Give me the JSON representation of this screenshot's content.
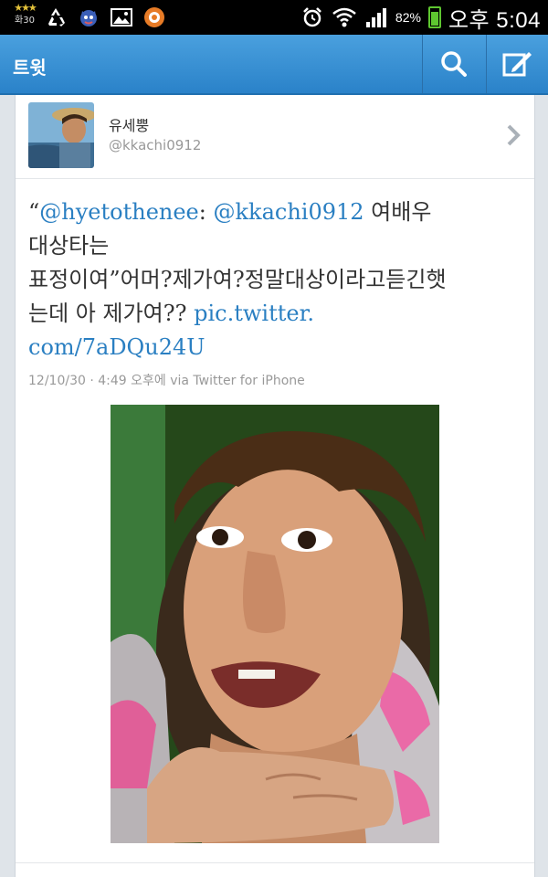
{
  "status_bar": {
    "day_label": "화30",
    "battery_text": "82%",
    "battery_level": 0.82,
    "time": "오후 5:04",
    "icons": [
      "weather-stars-icon",
      "recycle-icon",
      "mascot-icon",
      "gallery-icon",
      "ball-icon",
      "alarm-icon",
      "wifi-icon",
      "signal-icon",
      "battery-icon"
    ]
  },
  "action_bar": {
    "title": "트윗",
    "actions": [
      "search-icon",
      "compose-icon"
    ],
    "color": "#3a91d4"
  },
  "tweet": {
    "author_name": "유세뿡",
    "author_handle": "@kkachi0912",
    "text": {
      "quote_open": "“",
      "mention1": "@hyetothenee",
      "colon": ": ",
      "mention2": "@kkachi0912",
      "line1_rest": " 여배우",
      "line2": "대상타는",
      "line3": "표정이여”어머?제가여?정말대상이라고듣긴햇",
      "line4": "는데 아 제가여?? ",
      "link_part1": "pic.twitter.",
      "link_part2": "com/7aDQu24U"
    },
    "meta": "12/10/30 · 4:49 오후에 via Twitter for iPhone",
    "link_color": "#2a7fc2"
  }
}
